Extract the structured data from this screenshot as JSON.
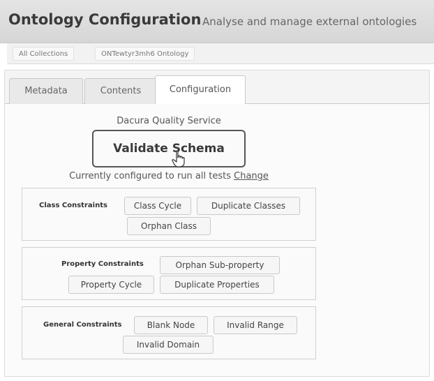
{
  "header": {
    "title": "Ontology Configuration",
    "subtitle": "Analyse and manage external ontologies"
  },
  "breadcrumbs": [
    "All Collections",
    "ONTewtyr3mh6 Ontology"
  ],
  "tabs": [
    {
      "label": "Metadata",
      "active": false
    },
    {
      "label": "Contents",
      "active": false
    },
    {
      "label": "Configuration",
      "active": true
    }
  ],
  "config": {
    "service_label": "Dacura Quality Service",
    "validate_label": "Validate Schema",
    "status_text": "Currently configured to run all tests",
    "change_label": "Change"
  },
  "groups": [
    {
      "label": "Class Constraints",
      "tests": [
        "Class Cycle",
        "Duplicate Classes",
        "Orphan Class"
      ]
    },
    {
      "label": "Property Constraints",
      "tests": [
        "Orphan Sub-property",
        "Property Cycle",
        "Duplicate Properties"
      ]
    },
    {
      "label": "General Constraints",
      "tests": [
        "Blank Node",
        "Invalid Range",
        "Invalid Domain"
      ]
    }
  ],
  "colors": {
    "header_bg": "#d9d9d9",
    "panel_bg": "#f4f4f4",
    "button_border": "#555555"
  },
  "icons": {
    "cursor": "hand-pointer-icon"
  }
}
